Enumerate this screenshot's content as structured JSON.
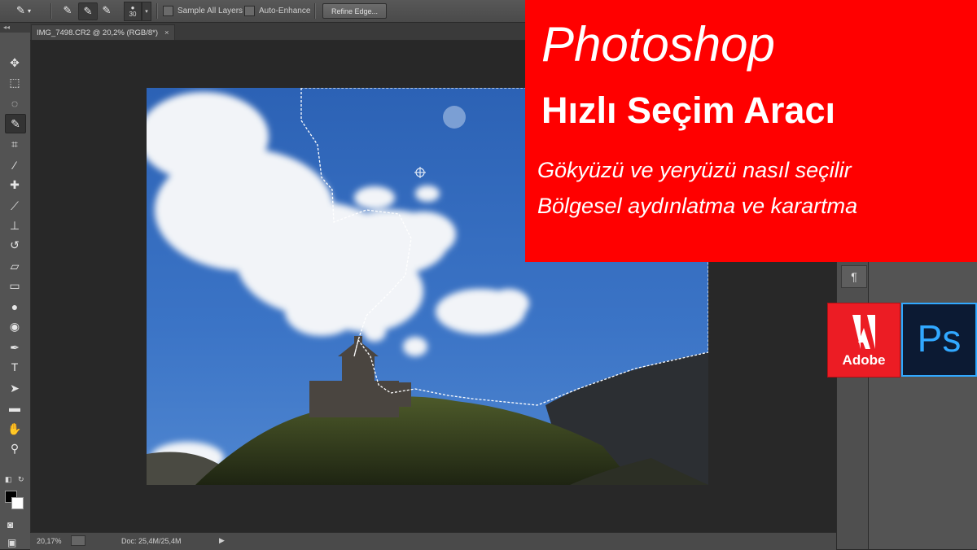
{
  "options_bar": {
    "brush_size": "30",
    "sample_all_layers_label": "Sample All Layers",
    "auto_enhance_label": "Auto-Enhance",
    "refine_edge_label": "Refine Edge..."
  },
  "document": {
    "tab_title": "IMG_7498.CR2 @ 20,2% (RGB/8*)",
    "close_glyph": "×"
  },
  "status_bar": {
    "zoom": "20,17%",
    "doc_info": "Doc: 25,4M/25,4M"
  },
  "panel": {
    "paragraph_glyph": "¶"
  },
  "banner": {
    "title_line1": "Photoshop",
    "title_line2": "Hızlı Seçim Aracı",
    "subtitle_line1": "Gökyüzü ve yeryüzü nasıl seçilir",
    "subtitle_line2": "Bölgesel aydınlatma ve karartma"
  },
  "logos": {
    "adobe_label": "Adobe",
    "ps_label": "Ps"
  },
  "tools": [
    {
      "icon": "move-icon",
      "glyph": "✥"
    },
    {
      "icon": "marquee-icon",
      "glyph": "⬚"
    },
    {
      "icon": "lasso-icon",
      "glyph": "◌"
    },
    {
      "icon": "quick-selection-icon",
      "glyph": "✎"
    },
    {
      "icon": "crop-icon",
      "glyph": "⌗"
    },
    {
      "icon": "eyedropper-icon",
      "glyph": "⁄"
    },
    {
      "icon": "healing-brush-icon",
      "glyph": "✚"
    },
    {
      "icon": "brush-icon",
      "glyph": "⟋"
    },
    {
      "icon": "clone-stamp-icon",
      "glyph": "⊥"
    },
    {
      "icon": "history-brush-icon",
      "glyph": "↺"
    },
    {
      "icon": "eraser-icon",
      "glyph": "▱"
    },
    {
      "icon": "gradient-icon",
      "glyph": "▭"
    },
    {
      "icon": "blur-icon",
      "glyph": "●"
    },
    {
      "icon": "dodge-icon",
      "glyph": "◉"
    },
    {
      "icon": "pen-icon",
      "glyph": "✒"
    },
    {
      "icon": "type-icon",
      "glyph": "T"
    },
    {
      "icon": "path-selection-icon",
      "glyph": "➤"
    },
    {
      "icon": "shape-icon",
      "glyph": "▬"
    },
    {
      "icon": "hand-icon",
      "glyph": "✋"
    },
    {
      "icon": "zoom-icon",
      "glyph": "⚲"
    }
  ],
  "colors": {
    "banner_red": "#ff0000",
    "adobe_red": "#ec1c24",
    "ps_blue": "#31a8ff",
    "ps_bg": "#0c1a33",
    "workspace": "#282828"
  }
}
